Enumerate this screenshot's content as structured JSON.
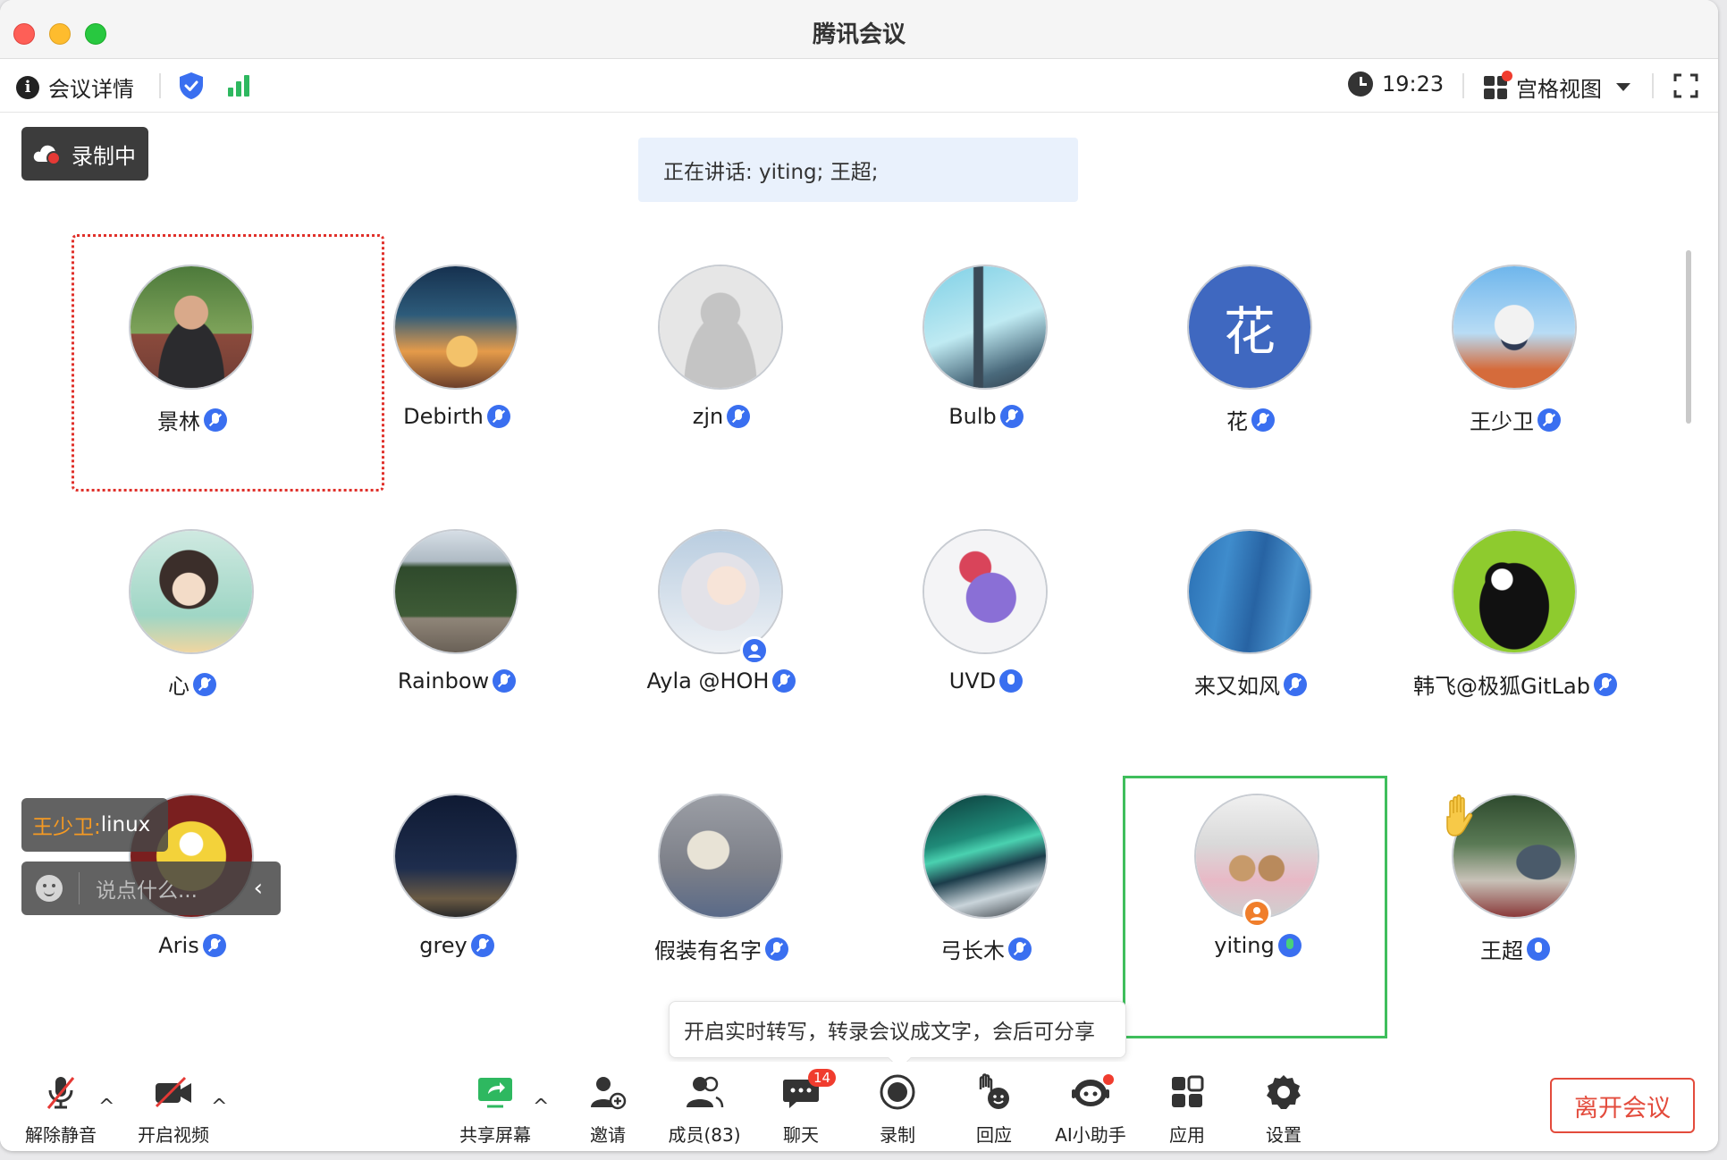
{
  "window": {
    "title": "腾讯会议"
  },
  "infobar": {
    "details_label": "会议详情",
    "time": "19:23",
    "view_label": "宫格视图"
  },
  "recording_badge": "录制中",
  "speaking_text": "正在讲话: yiting; 王超;",
  "participants": [
    {
      "name": "景林",
      "avatar": "photo-man",
      "mic": "muted"
    },
    {
      "name": "Debirth",
      "avatar": "art-sunset",
      "mic": "muted"
    },
    {
      "name": "zjn",
      "avatar": "default-gray",
      "mic": "muted"
    },
    {
      "name": "Bulb",
      "avatar": "eiffel-tower",
      "mic": "muted"
    },
    {
      "name": "花",
      "avatar_text": "花",
      "avatar": "text",
      "mic": "muted"
    },
    {
      "name": "王少卫",
      "avatar": "rabbit",
      "mic": "muted"
    },
    {
      "name": "心",
      "avatar": "anime-girl",
      "mic": "muted"
    },
    {
      "name": "Rainbow",
      "avatar": "trees",
      "mic": "muted"
    },
    {
      "name": "Ayla @HOH",
      "avatar": "anime-blonde",
      "mic": "muted",
      "badge": "host"
    },
    {
      "name": "UVD",
      "avatar": "purple-dino",
      "mic": "open"
    },
    {
      "name": "来又如风",
      "avatar": "blue-water",
      "mic": "muted"
    },
    {
      "name": "韩飞@极狐GitLab",
      "avatar": "penguin",
      "mic": "muted"
    },
    {
      "name": "Aris",
      "avatar": "minion",
      "mic": "muted"
    },
    {
      "name": "grey",
      "avatar": "night-sky",
      "mic": "muted"
    },
    {
      "name": "假装有名字",
      "avatar": "book",
      "mic": "muted"
    },
    {
      "name": "弓长木",
      "avatar": "aurora",
      "mic": "muted"
    },
    {
      "name": "yiting",
      "avatar": "store-bears",
      "mic": "speaking",
      "badge": "cohost"
    },
    {
      "name": "王超",
      "avatar": "street-photo",
      "mic": "open",
      "hand_raised": true
    }
  ],
  "chat": {
    "last_sender": "王少卫:",
    "last_message": " linux",
    "input_placeholder": "说点什么...",
    "collapse_icon": "‹"
  },
  "tooltip": "开启实时转写，转录会议成文字，会后可分享",
  "toolbar": {
    "unmute": "解除静音",
    "start_video": "开启视频",
    "share_screen": "共享屏幕",
    "invite": "邀请",
    "members": "成员(83)",
    "chat": "聊天",
    "chat_badge": "14",
    "record": "录制",
    "react": "回应",
    "ai_assistant": "AI小助手",
    "apps": "应用",
    "settings": "设置",
    "caret": "^",
    "leave": "离开会议"
  },
  "colors": {
    "accent_blue": "#3a6ff0",
    "leave_red": "#e34b3c",
    "speaking_green": "#3fbe5c",
    "badge_red": "#f03c2e"
  }
}
